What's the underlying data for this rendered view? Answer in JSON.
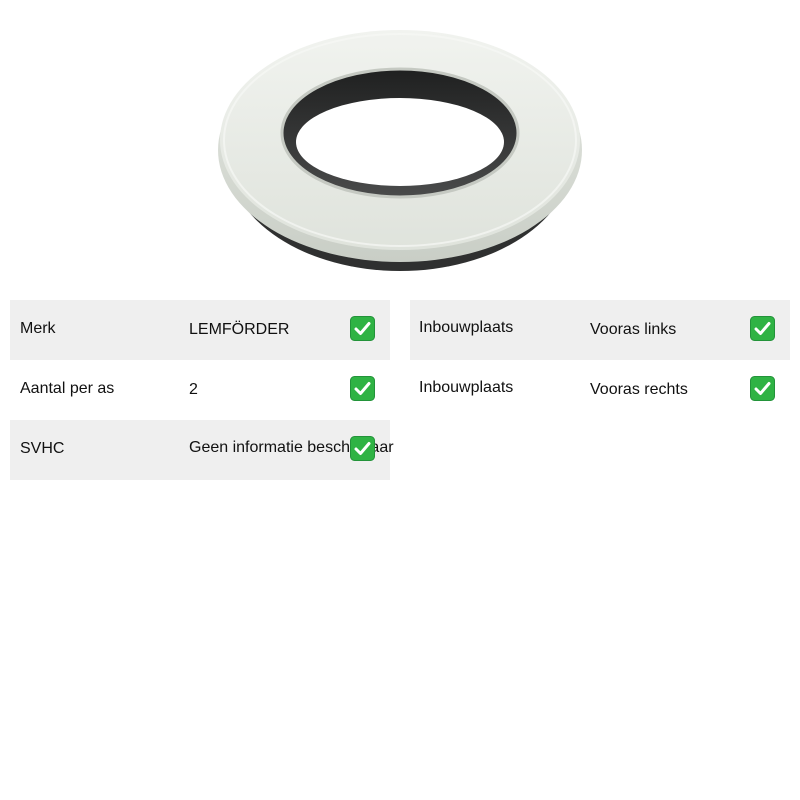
{
  "product": {
    "image_name": "strut-mount-bearing-ring"
  },
  "specs_left": [
    {
      "label": "Merk",
      "value": "LEMFÖRDER",
      "status_icon": "check-icon"
    },
    {
      "label": "Aantal per as",
      "value": "2",
      "status_icon": "check-icon"
    },
    {
      "label": "SVHC",
      "value": "Geen informatie beschikbaar",
      "status_icon": "check-icon"
    }
  ],
  "specs_right": [
    {
      "label": "Inbouwplaats",
      "value": "Vooras links",
      "status_icon": "check-icon"
    },
    {
      "label": "Inbouwplaats",
      "value": "Vooras rechts",
      "status_icon": "check-icon"
    }
  ],
  "colors": {
    "row_shade": "#efefef",
    "check_green": "#2fb344",
    "ring_white": "#e3e6e0",
    "seal_dark": "#2f3030"
  }
}
